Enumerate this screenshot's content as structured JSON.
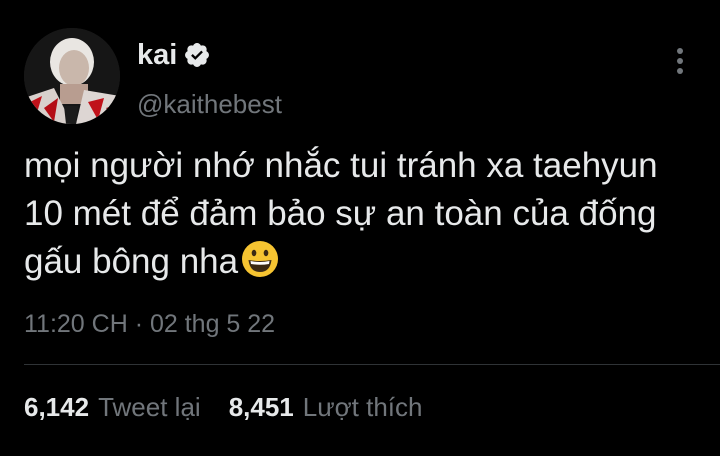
{
  "tweet": {
    "author": {
      "display_name": "kai",
      "handle": "@kaithebest",
      "verified": true,
      "avatar": "avatar-photo"
    },
    "text": "mọi người nhớ nhắc tui tránh xa taehyun 10 mét để đảm bảo sự an toàn của đống gấu bông nha",
    "emoji": "grinning-face-emoji",
    "timestamp": "11:20 CH · 02 thg 5 22",
    "stats": {
      "retweets": {
        "count": "6,142",
        "label": "Tweet lại"
      },
      "likes": {
        "count": "8,451",
        "label": "Lượt thích"
      }
    },
    "more_icon": "more-vertical-icon"
  },
  "colors": {
    "background": "#000000",
    "primary_text": "#e7e9ea",
    "secondary_text": "#71767b",
    "divider": "#2f3336",
    "verified_badge": "#e7e9ea"
  }
}
